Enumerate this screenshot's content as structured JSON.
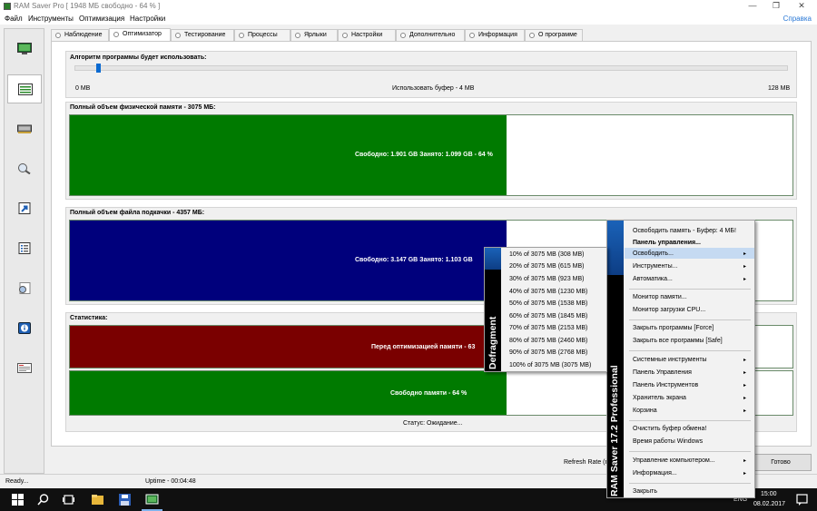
{
  "window": {
    "title": "RAM Saver Pro [ 1948 МБ свободно - 64 % ]",
    "min": "—",
    "restore": "❐",
    "close": "✕"
  },
  "menu": {
    "items": [
      "Файл",
      "Инструменты",
      "Оптимизация",
      "Настройки"
    ],
    "help": "Справка"
  },
  "sidebar": {
    "icons": [
      "monitor-icon",
      "list-icon",
      "memory-chip-icon",
      "magnifier-icon",
      "shortcut-icon",
      "checklist-icon",
      "settings-icon",
      "info-icon",
      "about-icon"
    ]
  },
  "tabs": [
    "Наблюдение",
    "Оптимизатор",
    "Тестирование",
    "Процессы",
    "Ярлыки",
    "Настройки",
    "Дополнительно",
    "Информация",
    "О программе"
  ],
  "optimizer": {
    "algorithm_label": "Алгоритм программы будет использовать:",
    "slider_min": "0 MB",
    "slider_center": "Использовать буфер - 4 MB",
    "slider_max": "128 MB",
    "slider_value_mb": 4,
    "physical_label": "Полный объем физической памяти - 3075 МБ:",
    "physical_text": "Свободно: 1.901 GB  Занято: 1.099 GB - 64 %",
    "physical_free_pct": 64,
    "pagefile_label": "Полный объем файла подкачки - 4357 МБ:",
    "pagefile_text": "Свободно: 3.147 GB  Занято: 1.103 GB",
    "stats_label": "Статистика:",
    "before_text": "Перед оптимизацией памяти - 63",
    "free_text": "Свободно памяти - 64 %",
    "status_text": "Статус: Ожидание..."
  },
  "footer": {
    "refresh_rate": "Refresh Rate (n",
    "done": "Готово"
  },
  "statusbar": {
    "ready": "Ready...",
    "uptime": "Uptime  -  00:04:48"
  },
  "taskbar": {
    "lang": "ENG",
    "time": "15:00",
    "date": "08.02.2017"
  },
  "context_menu": {
    "brand": "RAM Saver 17.2 Professional",
    "items": [
      "Освободить память - Буфер: 4 МБ!",
      "Панель управления...",
      "Освободить...",
      "Инструменты...",
      "Автоматика...",
      "Монитор памяти...",
      "Монитор загрузки CPU...",
      "Закрыть программы [Force]",
      "Закрыть все программы [Safe]",
      "Системные инструменты",
      "Панель Управления",
      "Панель Инструментов",
      "Хранитель экрана",
      "Корзина",
      "Очистить буфер обмена!",
      "Время работы Windows",
      "Управление компьютером...",
      "Информация...",
      "Закрыть"
    ],
    "arrow": "▸"
  },
  "submenu": {
    "brand": "Defragment",
    "items": [
      "10% of 3075 MB (308 MB)",
      "20% of 3075 MB (615 MB)",
      "30% of 3075 MB (923 MB)",
      "40% of 3075 MB (1230 MB)",
      "50% of 3075 MB (1538 MB)",
      "60% of 3075 MB (1845 MB)",
      "70% of 3075 MB (2153 MB)",
      "80% of 3075 MB (2460 MB)",
      "90% of 3075 MB (2768 MB)",
      "100% of 3075 MB (3075 MB)"
    ]
  },
  "colors": {
    "green": "#007a00",
    "navy": "#00007c",
    "maroon": "#7a0000",
    "accent": "#0a6ad1"
  }
}
